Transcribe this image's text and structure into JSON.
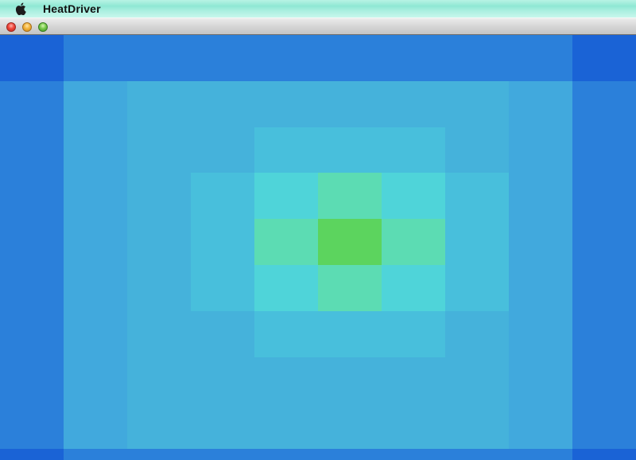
{
  "menubar": {
    "app_icon": "apple-logo-icon",
    "app_name": "HeatDriver"
  },
  "window": {
    "buttons": [
      "close",
      "minimize",
      "zoom"
    ],
    "title": ""
  },
  "heatmap": {
    "columns": 10,
    "rows": 10,
    "colors": {
      "edge_dark": "#1a63d6",
      "blue_edge": "#2b80da",
      "blue_mid": "#41a9dd",
      "blue_light": "#45b2db",
      "cyan_light": "#48bfdc",
      "aqua": "#4fd4d9",
      "sea_green": "#5cdcb3",
      "hot_green": "#5cd45e"
    },
    "grid": [
      [
        "edge_dark",
        "blue_edge",
        "blue_edge",
        "blue_edge",
        "blue_edge",
        "blue_edge",
        "blue_edge",
        "blue_edge",
        "blue_edge",
        "edge_dark"
      ],
      [
        "blue_edge",
        "blue_mid",
        "blue_light",
        "blue_light",
        "blue_light",
        "blue_light",
        "blue_light",
        "blue_light",
        "blue_mid",
        "blue_edge"
      ],
      [
        "blue_edge",
        "blue_mid",
        "blue_light",
        "blue_light",
        "cyan_light",
        "cyan_light",
        "cyan_light",
        "blue_light",
        "blue_mid",
        "blue_edge"
      ],
      [
        "blue_edge",
        "blue_mid",
        "blue_light",
        "cyan_light",
        "aqua",
        "sea_green",
        "aqua",
        "cyan_light",
        "blue_mid",
        "blue_edge"
      ],
      [
        "blue_edge",
        "blue_mid",
        "blue_light",
        "cyan_light",
        "sea_green",
        "hot_green",
        "sea_green",
        "cyan_light",
        "blue_mid",
        "blue_edge"
      ],
      [
        "blue_edge",
        "blue_mid",
        "blue_light",
        "cyan_light",
        "aqua",
        "sea_green",
        "aqua",
        "cyan_light",
        "blue_mid",
        "blue_edge"
      ],
      [
        "blue_edge",
        "blue_mid",
        "blue_light",
        "blue_light",
        "cyan_light",
        "cyan_light",
        "cyan_light",
        "blue_light",
        "blue_mid",
        "blue_edge"
      ],
      [
        "blue_edge",
        "blue_mid",
        "blue_light",
        "blue_light",
        "blue_light",
        "blue_light",
        "blue_light",
        "blue_light",
        "blue_mid",
        "blue_edge"
      ],
      [
        "blue_edge",
        "blue_mid",
        "blue_light",
        "blue_light",
        "blue_light",
        "blue_light",
        "blue_light",
        "blue_light",
        "blue_mid",
        "blue_edge"
      ],
      [
        "edge_dark",
        "blue_edge",
        "blue_edge",
        "blue_edge",
        "blue_edge",
        "blue_edge",
        "blue_edge",
        "blue_edge",
        "blue_edge",
        "edge_dark"
      ]
    ]
  }
}
